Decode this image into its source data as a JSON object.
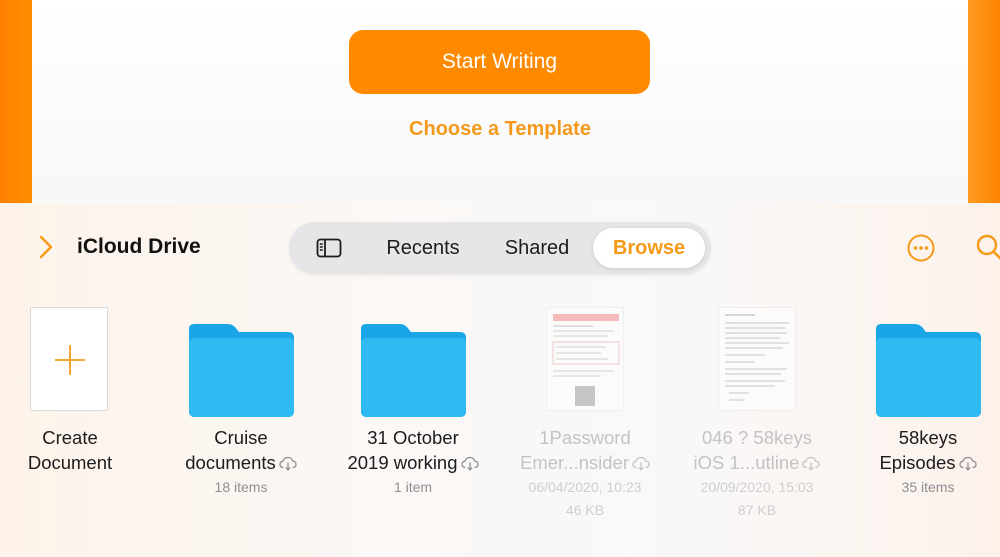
{
  "top": {
    "start_writing_label": "Start Writing",
    "choose_template_label": "Choose a Template"
  },
  "nav": {
    "location_title": "iCloud Drive",
    "tabs": [
      {
        "label": "Recents"
      },
      {
        "label": "Shared"
      },
      {
        "label": "Browse",
        "selected": true
      }
    ],
    "icons": [
      "chevron-right-icon",
      "sidebar-icon",
      "more-icon",
      "search-icon"
    ]
  },
  "items": [
    {
      "line1": "Create",
      "line2": "Document",
      "kind": "create"
    },
    {
      "line1": "Cruise",
      "line2": "documents",
      "meta1": "18 items",
      "kind": "folder",
      "cloud": true
    },
    {
      "line1": "31 October",
      "line2": "2019 working",
      "meta1": "1 item",
      "kind": "folder",
      "cloud": true
    },
    {
      "line1": "1Password",
      "line2": "Emer...nsider",
      "meta1": "06/04/2020, 10:23",
      "meta2": "46 KB",
      "kind": "document",
      "cloud": true,
      "dimmed": true
    },
    {
      "line1": "046 ? 58keys",
      "line2": "iOS 1...utline",
      "meta1": "20/09/2020, 15:03",
      "meta2": "87 KB",
      "kind": "document",
      "cloud": true,
      "dimmed": true
    },
    {
      "line1": "58keys",
      "line2": "Episodes",
      "meta1": "35 items",
      "kind": "folder",
      "cloud": true
    }
  ],
  "colors": {
    "accent": "#ff8a00",
    "accent_text": "#f59a17",
    "folder": "#29b5f0"
  }
}
